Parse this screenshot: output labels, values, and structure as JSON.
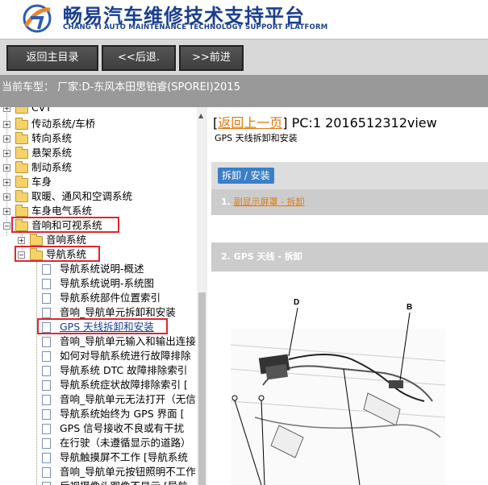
{
  "header": {
    "title_cn": "畅易汽车维修技术支持平台",
    "title_en": "CHANG YI AUTO MAINTENANCE TECHNOLOGY SUPPORT PLATFORM"
  },
  "toolbar": {
    "home": "返回主目录",
    "back": "<<后退.",
    "forward": ">>前进"
  },
  "current_model": "当前车型：  厂家:D-东风本田思铂睿(SPOREI)2015",
  "tree": {
    "top_partial": "CVT",
    "items": [
      {
        "label": "传动系统/车桥"
      },
      {
        "label": "转向系统"
      },
      {
        "label": "悬架系统"
      },
      {
        "label": "制动系统"
      },
      {
        "label": "车身"
      },
      {
        "label": "取暖、通风和空调系统"
      },
      {
        "label": "车身电气系统"
      },
      {
        "label": "音响和可视系统"
      },
      {
        "label": "音响系统"
      },
      {
        "label": "导航系统"
      }
    ],
    "docs": [
      "导航系统说明-概述",
      "导航系统说明-系统图",
      "导航系统部件位置索引",
      "音响_导航单元拆卸和安装",
      "GPS 天线拆卸和安装",
      "音响_导航单元输入和输出连接",
      "如何对导航系统进行故障排除",
      "导航系统 DTC 故障排除索引",
      "导航系统症状故障排除索引 [",
      "音响_导航单元无法打开（无信",
      "导航系统始终为 GPS 界面 [",
      "GPS 信号接收不良或有干扰",
      "在行驶（未遵循显示的道路）",
      "导航触摸屏不工作 [导航系统",
      "音响_导航单元按钮照明不工作",
      "后视摄像头图像不显示 [导航"
    ]
  },
  "content": {
    "back_link": "返回上一页",
    "pc_info": " PC:1 2016512312view",
    "doc_title": "GPS 天线拆卸和安装",
    "tab_label": "拆卸 / 安装",
    "step1_num": "1.",
    "step1_link": "副显示屏罩 - 拆卸",
    "step2": "2. GPS 天线 - 拆卸",
    "label_d": "D",
    "label_b": "B"
  },
  "colors": {
    "brand_blue": "#1a3f8f",
    "highlight_red": "#e0262f",
    "link_orange": "#e07a10",
    "tab_blue": "#3a7fc8"
  }
}
